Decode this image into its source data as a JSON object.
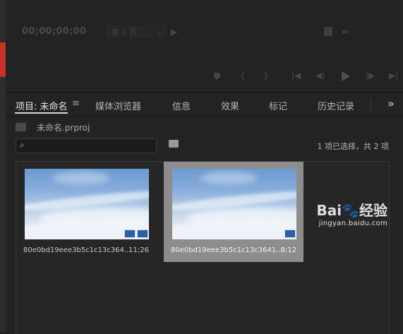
{
  "program_monitor": {
    "timecode": "00;00;00;00",
    "page_selector": "第 1 页"
  },
  "project_panel": {
    "tabs": [
      {
        "label": "项目: 未命名"
      },
      {
        "label": "媒体浏览器"
      },
      {
        "label": "信息"
      },
      {
        "label": "效果"
      },
      {
        "label": "标记"
      },
      {
        "label": "历史记录"
      }
    ],
    "overflow_label": "»",
    "project_file": "未命名.prproj",
    "search": {
      "value": "",
      "placeholder": ""
    },
    "selection_status": "1 项已选择，共 2 项",
    "clips": [
      {
        "name": "80e0bd19eee3b5c1c13c364...",
        "duration": "11;26",
        "selected": false
      },
      {
        "name": "80e0bd19eee3b5c1c13c3641...",
        "duration": "8;12",
        "selected": true
      }
    ]
  },
  "watermark": {
    "logo": "Bai🐾经验",
    "url": "jingyan.baidu.com"
  },
  "colors": {
    "background": "#232323",
    "accent_red": "#c8322b",
    "selection": "#8d8d8d",
    "badge_blue": "#2c5fa8"
  }
}
